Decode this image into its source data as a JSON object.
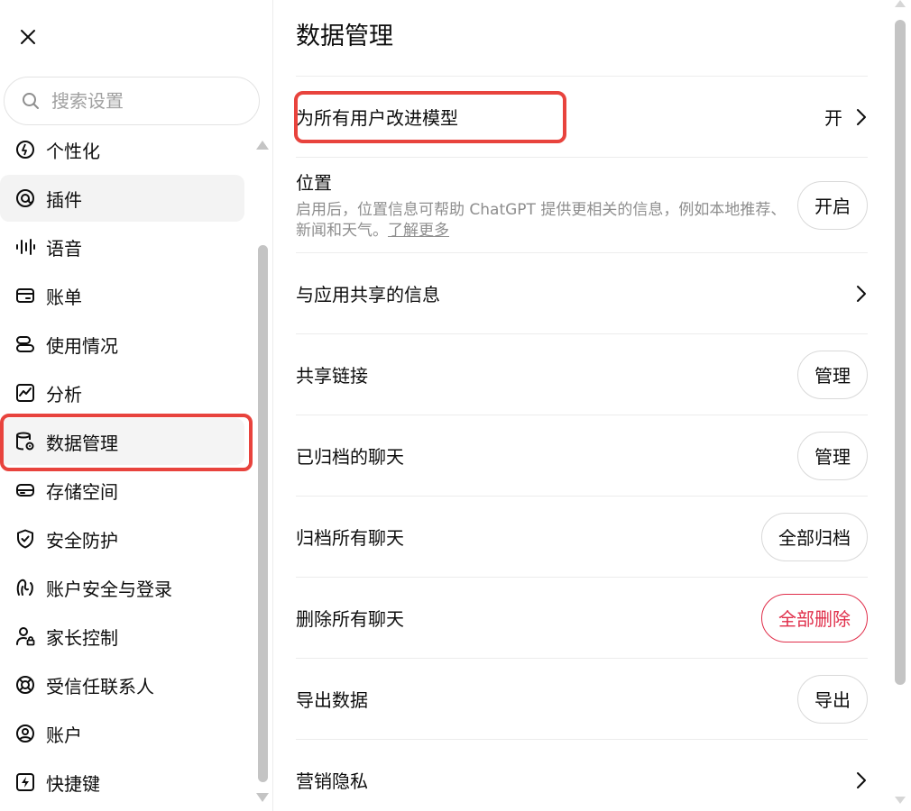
{
  "sidebar": {
    "search_placeholder": "搜索设置",
    "items": [
      {
        "label": "个性化",
        "icon": "personalization-icon"
      },
      {
        "label": "插件",
        "icon": "plugin-icon"
      },
      {
        "label": "语音",
        "icon": "voice-wave-icon"
      },
      {
        "label": "账单",
        "icon": "billing-card-icon"
      },
      {
        "label": "使用情况",
        "icon": "usage-icon"
      },
      {
        "label": "分析",
        "icon": "analytics-chart-icon"
      },
      {
        "label": "数据管理",
        "icon": "data-database-gear-icon"
      },
      {
        "label": "存储空间",
        "icon": "storage-drive-icon"
      },
      {
        "label": "安全防护",
        "icon": "shield-check-icon"
      },
      {
        "label": "账户安全与登录",
        "icon": "security-login-icon"
      },
      {
        "label": "家长控制",
        "icon": "parental-user-lock-icon"
      },
      {
        "label": "受信任联系人",
        "icon": "lifebuoy-icon"
      },
      {
        "label": "账户",
        "icon": "account-user-icon"
      },
      {
        "label": "快捷键",
        "icon": "shortcut-bolt-icon"
      }
    ],
    "active_item": "数据管理"
  },
  "main": {
    "title": "数据管理",
    "improve_model": {
      "label": "为所有用户改进模型",
      "value": "开"
    },
    "location": {
      "label": "位置",
      "description": "启用后，位置信息可帮助 ChatGPT 提供更相关的信息，例如本地推荐、新闻和天气。",
      "link": "了解更多",
      "button": "开启"
    },
    "shared_info": {
      "label": "与应用共享的信息"
    },
    "shared_links": {
      "label": "共享链接",
      "button": "管理"
    },
    "archived_chats": {
      "label": "已归档的聊天",
      "button": "管理"
    },
    "archive_all": {
      "label": "归档所有聊天",
      "button": "全部归档"
    },
    "delete_all": {
      "label": "删除所有聊天",
      "button": "全部删除"
    },
    "export": {
      "label": "导出数据",
      "button": "导出"
    },
    "marketing": {
      "label": "营销隐私"
    }
  },
  "colors": {
    "highlight": "#e8433d",
    "danger": "#e02e4a"
  }
}
